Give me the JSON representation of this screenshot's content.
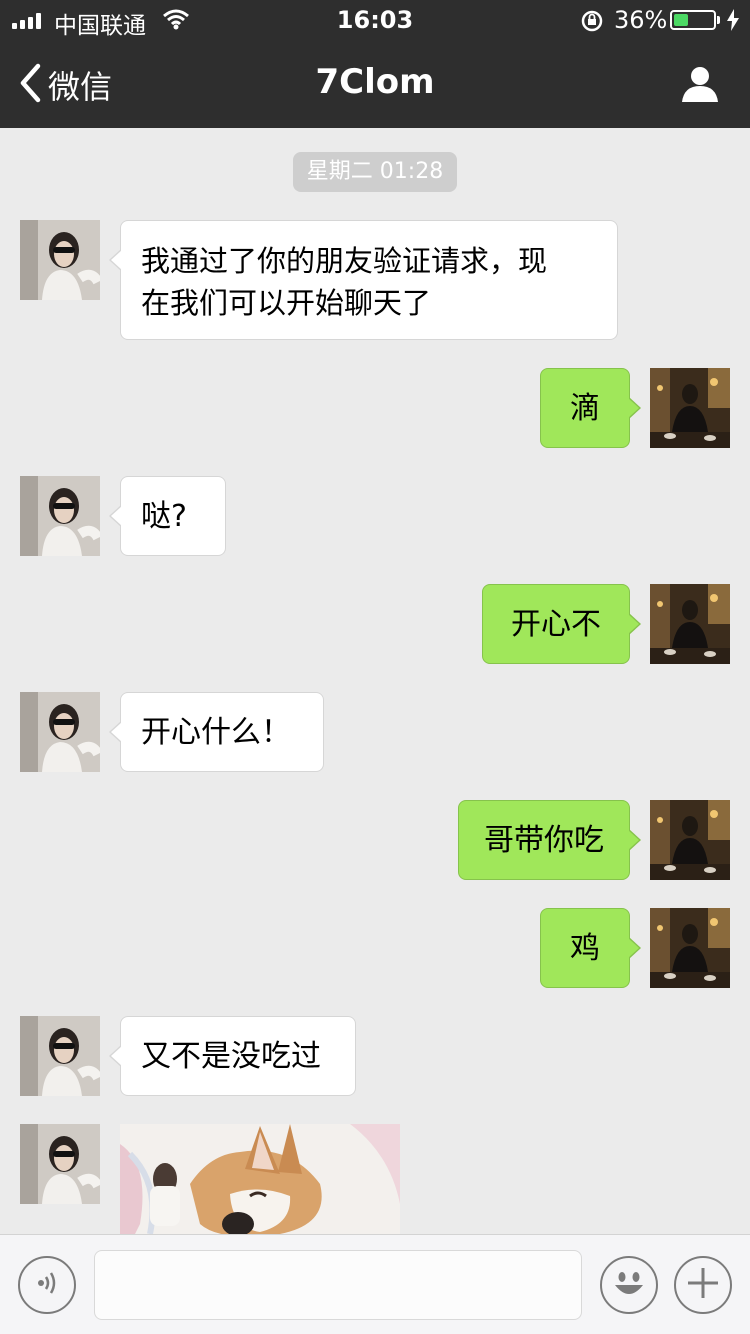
{
  "status_bar": {
    "carrier": "中国联通",
    "time": "16:03",
    "battery_percent": "36%",
    "battery_level": 0.36,
    "icons": [
      "signal-icon",
      "wifi-icon",
      "orientation-lock-icon",
      "battery-icon",
      "charging-icon"
    ]
  },
  "nav": {
    "back_label": "微信",
    "title": "7Clom",
    "icons": [
      "back-chevron-icon",
      "profile-icon"
    ]
  },
  "chat": {
    "timestamp": "星期二 01:28",
    "messages": [
      {
        "from": "other",
        "text": "我通过了你的朋友验证请求，现\n在我们可以开始聊天了"
      },
      {
        "from": "me",
        "text": "滴"
      },
      {
        "from": "other",
        "text": "哒?"
      },
      {
        "from": "me",
        "text": "开心不"
      },
      {
        "from": "other",
        "text": "开心什么！"
      },
      {
        "from": "me",
        "text": "哥带你吃"
      },
      {
        "from": "me",
        "text": "鸡"
      },
      {
        "from": "other",
        "text": "又不是没吃过"
      },
      {
        "from": "other",
        "type": "image",
        "content": "corgi-photo"
      }
    ]
  },
  "input_bar": {
    "value": "",
    "icons": [
      "voice-icon",
      "emoji-icon",
      "add-icon"
    ]
  },
  "colors": {
    "nav_bg": "#2e2e2e",
    "chat_bg": "#ebebeb",
    "bubble_me": "#a0e75a",
    "bubble_other": "#ffffff",
    "battery_fill": "#4cd964"
  }
}
